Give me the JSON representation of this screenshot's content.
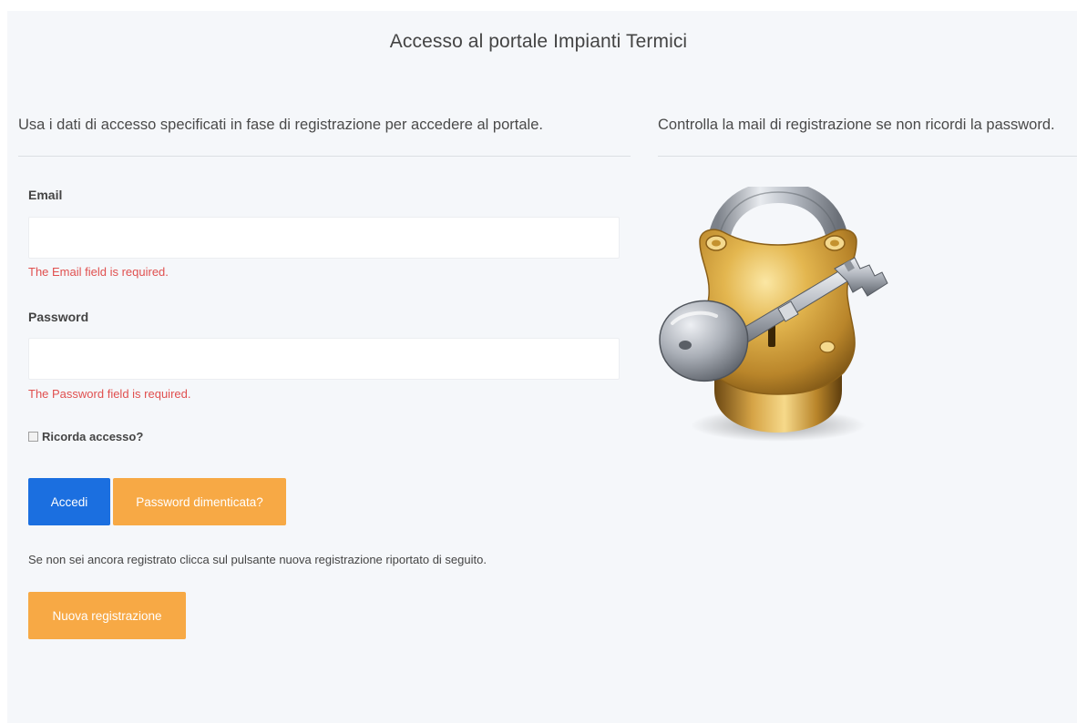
{
  "header": {
    "title": "Accesso al portale Impianti Termici"
  },
  "intro": {
    "left_text": "Usa i dati di accesso specificati in fase di registrazione per accedere al portale.",
    "right_text": "Controlla la mail di registrazione se non ricordi la password."
  },
  "form": {
    "email_label": "Email",
    "email_value": "",
    "email_error": "The Email field is required.",
    "password_label": "Password",
    "password_value": "",
    "password_error": "The Password field is required.",
    "remember_label": "Ricorda accesso?",
    "remember_checked": false,
    "login_button": "Accedi",
    "forgot_button": "Password dimenticata?"
  },
  "register": {
    "hint": "Se non sei ancora registrato clicca sul pulsante nuova registrazione riportato di seguito.",
    "button": "Nuova registrazione"
  },
  "illustration": {
    "icon": "padlock-with-key-icon"
  },
  "colors": {
    "primary_button": "#1b6fe0",
    "warning_button": "#f7a945",
    "error_text": "#e0504f",
    "page_background": "#f5f7fa"
  }
}
